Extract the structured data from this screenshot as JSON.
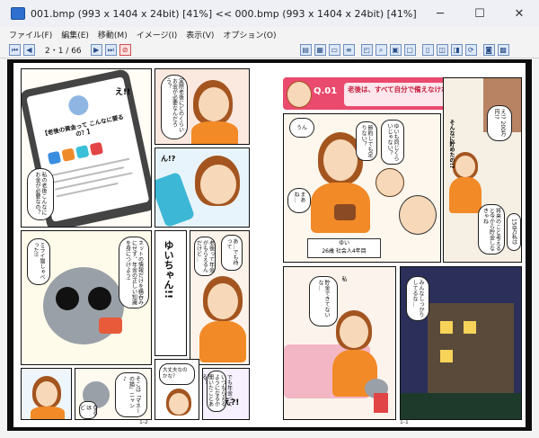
{
  "window": {
    "title": "001.bmp (993 x 1404 x 24bit) [41%]   <<   000.bmp (993 x 1404 x 24bit) [41%]",
    "minimize": "─",
    "maximize": "☐",
    "close": "✕"
  },
  "menu": [
    "ファイル(F)",
    "編集(E)",
    "移動(M)",
    "イメージ(I)",
    "表示(V)",
    "オプション(O)"
  ],
  "toolbar": {
    "page_indicator": "2・1 / 66"
  },
  "pages": {
    "left_number": "1-2",
    "right_number": "1-1"
  },
  "manga": {
    "q_label": "Q.01",
    "q_text": "老後は、すべて自分で備えなければいけないの？",
    "phone_heading": "【老後の資金って こんなに要るの？】",
    "character_name": "ゆい",
    "character_caption": "26歳 社会人4年目",
    "sfx_e": "え!!",
    "sfx_n": "ん!?",
    "sfx_e2": "え?!",
    "yui_shout": "ゆいちゃん!!",
    "bubble_1": "実際老後にどのくらいお金が必要なんだろう？",
    "bubble_2": "私の老後こんなにお金が必要なの？",
    "bubble_3": "ネットの情報だけを鵜呑みにせず、年金の正しい知識を身につけよう!",
    "bubble_4": "ミライ猫しゃべった!!",
    "bubble_5": "老後って年金がもらえるんだけど…",
    "bubble_6": "あ…でも待って",
    "bubble_7": "大丈夫なのかな？",
    "bubble_8": "そこは「マネーの猫」ニャン♪",
    "bubble_9": "でも年金っていつもらえるようになるか聞いたことある？",
    "bubble_10": "なるほど…",
    "bubble_r1": "うん",
    "bubble_r2": "ゆいも同じくらいじゃない？",
    "bubble_r3": "節約しても足りない？",
    "bubble_r4": "まあね…",
    "bubble_r5": "え!? 200万円!?",
    "bubble_r6": "そんなに貯めたの!?",
    "bubble_r7": "将来のこと考えると今から貯金しなきゃね",
    "bubble_r8": "150万私は",
    "bubble_r9": "私",
    "bubble_r10": "みんなしっかりしてるな…",
    "bubble_r11": "貯金できてないな…"
  }
}
